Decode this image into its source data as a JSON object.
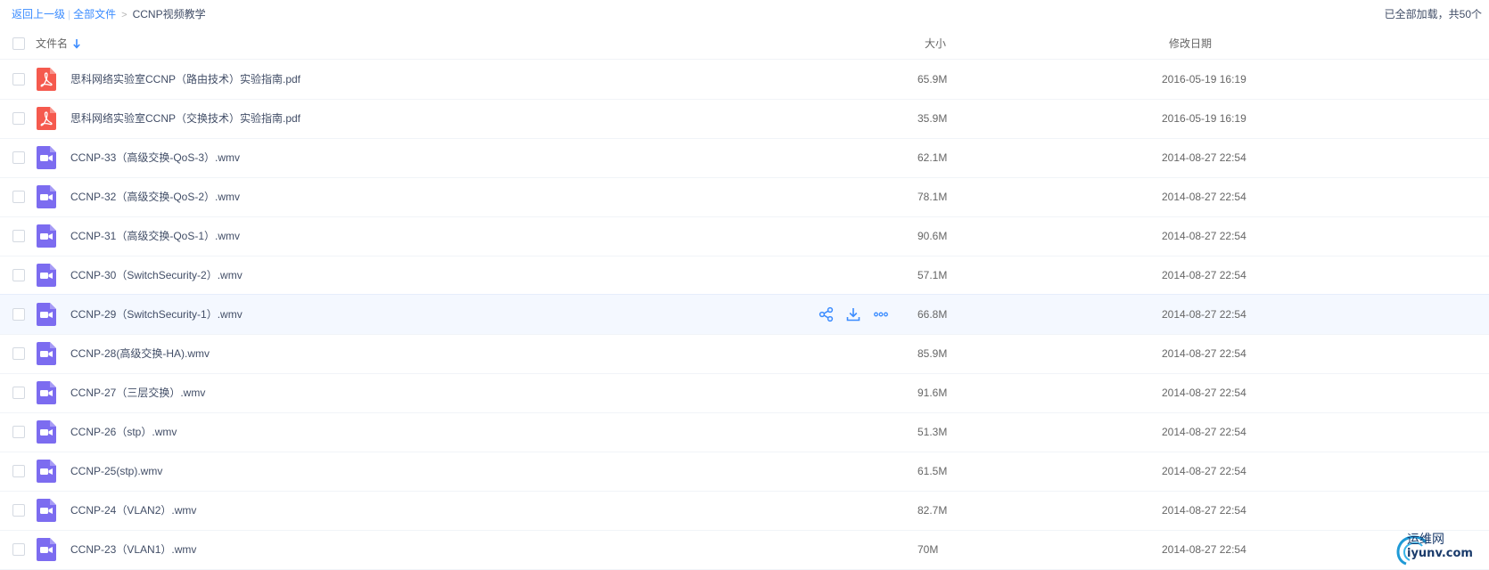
{
  "breadcrumb": {
    "back": "返回上一级",
    "sep": "|",
    "all_files": "全部文件",
    "arrow": ">",
    "current": "CCNP视频教学"
  },
  "status_text": "已全部加载，共50个",
  "columns": {
    "name": "文件名",
    "size": "大小",
    "date": "修改日期"
  },
  "files": [
    {
      "name": "思科网络实验室CCNP（路由技术）实验指南.pdf",
      "type": "pdf",
      "size": "65.9M",
      "date": "2016-05-19 16:19"
    },
    {
      "name": "思科网络实验室CCNP（交换技术）实验指南.pdf",
      "type": "pdf",
      "size": "35.9M",
      "date": "2016-05-19 16:19"
    },
    {
      "name": "CCNP-33（高级交换-QoS-3）.wmv",
      "type": "video",
      "size": "62.1M",
      "date": "2014-08-27 22:54"
    },
    {
      "name": "CCNP-32（高级交换-QoS-2）.wmv",
      "type": "video",
      "size": "78.1M",
      "date": "2014-08-27 22:54"
    },
    {
      "name": "CCNP-31（高级交换-QoS-1）.wmv",
      "type": "video",
      "size": "90.6M",
      "date": "2014-08-27 22:54"
    },
    {
      "name": "CCNP-30（SwitchSecurity-2）.wmv",
      "type": "video",
      "size": "57.1M",
      "date": "2014-08-27 22:54"
    },
    {
      "name": "CCNP-29（SwitchSecurity-1）.wmv",
      "type": "video",
      "size": "66.8M",
      "date": "2014-08-27 22:54",
      "hover": true
    },
    {
      "name": "CCNP-28(高级交换-HA).wmv",
      "type": "video",
      "size": "85.9M",
      "date": "2014-08-27 22:54"
    },
    {
      "name": "CCNP-27（三层交换）.wmv",
      "type": "video",
      "size": "91.6M",
      "date": "2014-08-27 22:54"
    },
    {
      "name": "CCNP-26（stp）.wmv",
      "type": "video",
      "size": "51.3M",
      "date": "2014-08-27 22:54"
    },
    {
      "name": "CCNP-25(stp).wmv",
      "type": "video",
      "size": "61.5M",
      "date": "2014-08-27 22:54"
    },
    {
      "name": "CCNP-24（VLAN2）.wmv",
      "type": "video",
      "size": "82.7M",
      "date": "2014-08-27 22:54"
    },
    {
      "name": "CCNP-23（VLAN1）.wmv",
      "type": "video",
      "size": "70M",
      "date": "2014-08-27 22:54"
    }
  ],
  "colors": {
    "link": "#3b8cff",
    "pdf": "#f55a4e",
    "video": "#7c6cf0",
    "hover_bg": "#f4f8ff"
  },
  "watermark": {
    "cn": "运维网",
    "en": "iyunv.com"
  }
}
